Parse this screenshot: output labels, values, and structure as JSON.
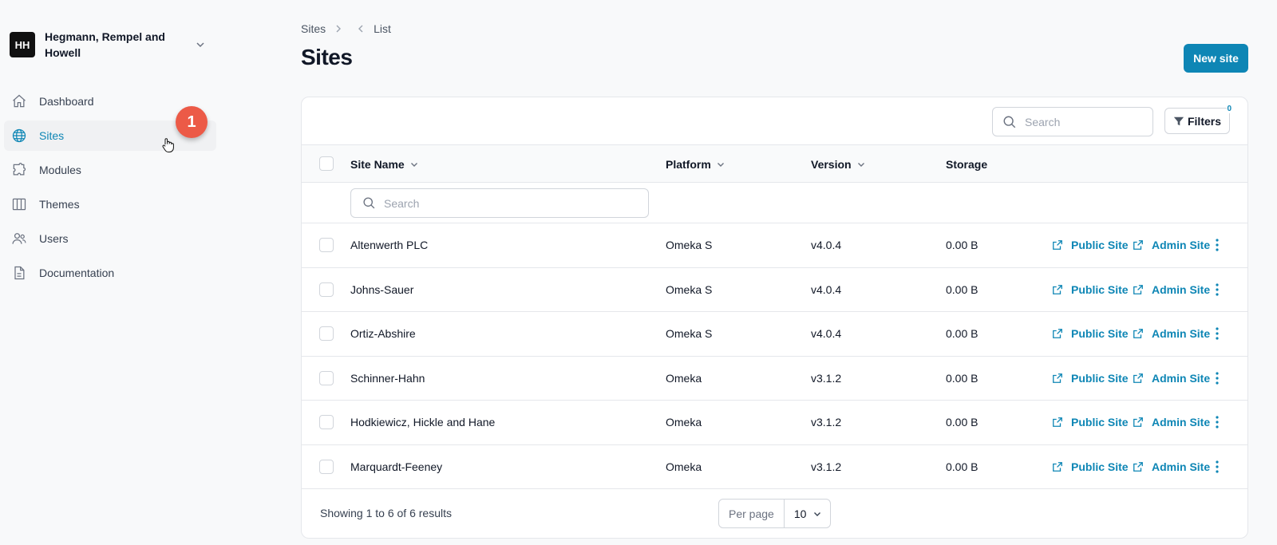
{
  "org": {
    "initials": "HH",
    "name": "Hegmann, Rempel and Howell"
  },
  "nav": {
    "items": [
      {
        "label": "Dashboard",
        "icon": "home-icon"
      },
      {
        "label": "Sites",
        "icon": "globe-icon",
        "active": true
      },
      {
        "label": "Modules",
        "icon": "puzzle-icon"
      },
      {
        "label": "Themes",
        "icon": "columns-icon"
      },
      {
        "label": "Users",
        "icon": "users-icon"
      },
      {
        "label": "Documentation",
        "icon": "document-icon"
      }
    ]
  },
  "annotation_badge": "1",
  "breadcrumb": {
    "first": "Sites",
    "second": "List"
  },
  "page_title": "Sites",
  "new_site_label": "New site",
  "toolbar": {
    "search_placeholder": "Search",
    "filters_label": "Filters",
    "filters_count": "0"
  },
  "columns": {
    "name": "Site Name",
    "platform": "Platform",
    "version": "Version",
    "storage": "Storage"
  },
  "column_search_placeholder": "Search",
  "rows": [
    {
      "name": "Altenwerth PLC",
      "platform": "Omeka S",
      "version": "v4.0.4",
      "storage": "0.00 B"
    },
    {
      "name": "Johns-Sauer",
      "platform": "Omeka S",
      "version": "v4.0.4",
      "storage": "0.00 B"
    },
    {
      "name": "Ortiz-Abshire",
      "platform": "Omeka S",
      "version": "v4.0.4",
      "storage": "0.00 B"
    },
    {
      "name": "Schinner-Hahn",
      "platform": "Omeka",
      "version": "v3.1.2",
      "storage": "0.00 B"
    },
    {
      "name": "Hodkiewicz, Hickle and Hane",
      "platform": "Omeka",
      "version": "v3.1.2",
      "storage": "0.00 B"
    },
    {
      "name": "Marquardt-Feeney",
      "platform": "Omeka",
      "version": "v3.1.2",
      "storage": "0.00 B"
    }
  ],
  "row_actions": {
    "public": "Public Site",
    "admin": "Admin Site"
  },
  "footer": {
    "showing": "Showing 1 to 6 of 6 results",
    "per_page_label": "Per page",
    "per_page_value": "10"
  },
  "colors": {
    "accent": "#0e86b5",
    "badge": "#ec5a47"
  }
}
